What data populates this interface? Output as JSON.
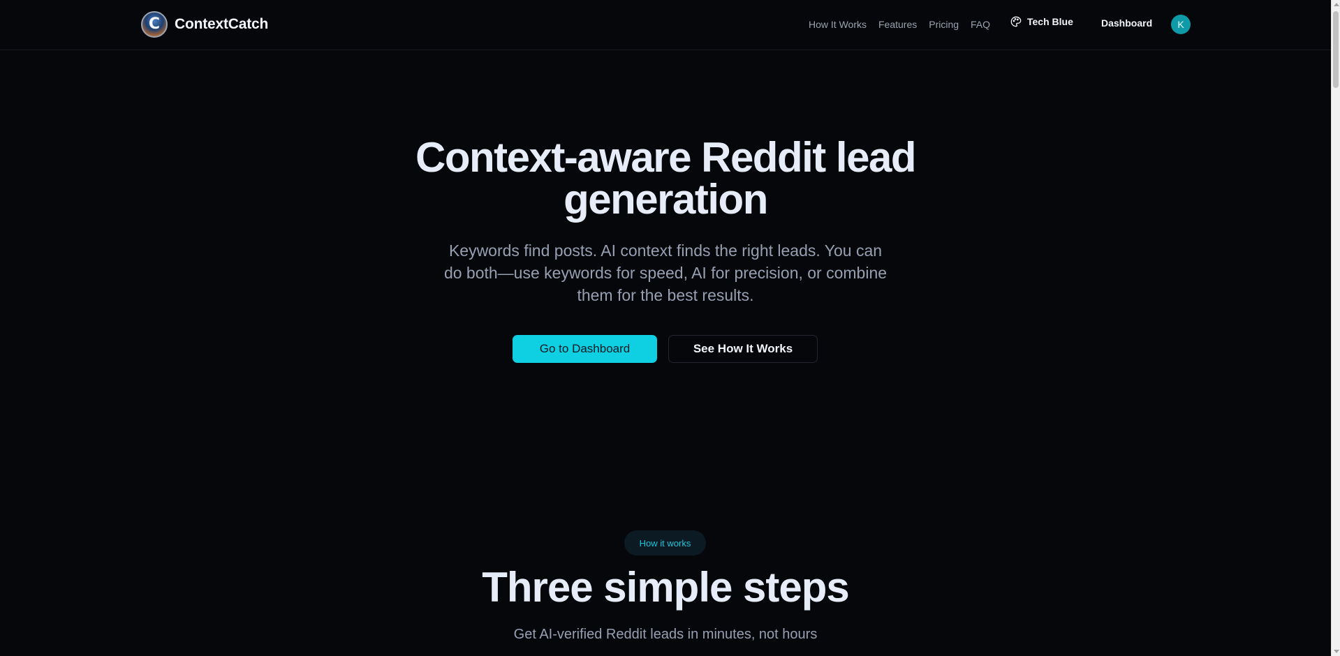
{
  "header": {
    "brand": "ContextCatch",
    "nav": [
      "How It Works",
      "Features",
      "Pricing",
      "FAQ"
    ],
    "theme_label": "Tech Blue",
    "dashboard_label": "Dashboard",
    "avatar_initial": "K"
  },
  "hero": {
    "title_line1": "Context-aware Reddit lead",
    "title_line2": "generation",
    "subtitle": "Keywords find posts. AI context finds the right leads. You can do both—use keywords for speed, AI for precision, or combine them for the best results.",
    "primary_cta": "Go to Dashboard",
    "secondary_cta": "See How It Works"
  },
  "how_it_works": {
    "pill": "How it works",
    "title": "Three simple steps",
    "subtitle": "Get AI-verified Reddit leads in minutes, not hours"
  },
  "colors": {
    "background": "#06070b",
    "accent": "#0fcfe3",
    "avatar": "#0e9aa7"
  }
}
